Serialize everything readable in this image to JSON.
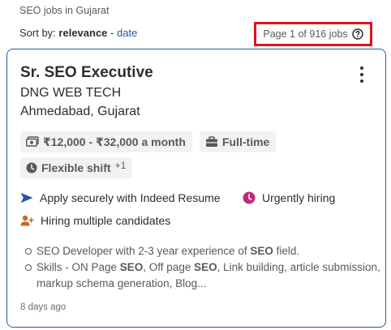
{
  "breadcrumb": "SEO jobs in Gujarat",
  "sort": {
    "label": "Sort by:",
    "current": "relevance",
    "separator": "-",
    "alternate": "date"
  },
  "pagination": {
    "text": "Page 1 of 916 jobs",
    "help_icon": "question-circle-icon"
  },
  "job": {
    "title": "Sr. SEO Executive",
    "company": "DNG WEB TECH",
    "location": "Ahmedabad, Gujarat",
    "more_icon": "kebab-menu-icon",
    "salary": "₹12,000 - ₹32,000 a month",
    "job_type": "Full-time",
    "shift": "Flexible shift",
    "shift_extra": "+1",
    "apply_text": "Apply securely with Indeed Resume",
    "urgent_text": "Urgently hiring",
    "hiring_text": "Hiring multiple candidates",
    "snippet": [
      {
        "parts": [
          {
            "text": "SEO Developer with 2-3 year experience of ",
            "bold": false
          },
          {
            "text": "SEO",
            "bold": true
          },
          {
            "text": " field.",
            "bold": false
          }
        ]
      },
      {
        "parts": [
          {
            "text": "Skills - ON Page ",
            "bold": false
          },
          {
            "text": "SEO",
            "bold": true
          },
          {
            "text": ", Off page ",
            "bold": false
          },
          {
            "text": "SEO",
            "bold": true
          },
          {
            "text": ", Link building, article submission, markup schema generation, Blog...",
            "bold": false
          }
        ]
      }
    ],
    "posted": "8 days ago"
  },
  "colors": {
    "link": "#2557a7",
    "highlight_border": "#e0121f",
    "urgent": "#c2297b",
    "apply_arrow": "#2557a7",
    "hiring": "#c46b2b"
  }
}
